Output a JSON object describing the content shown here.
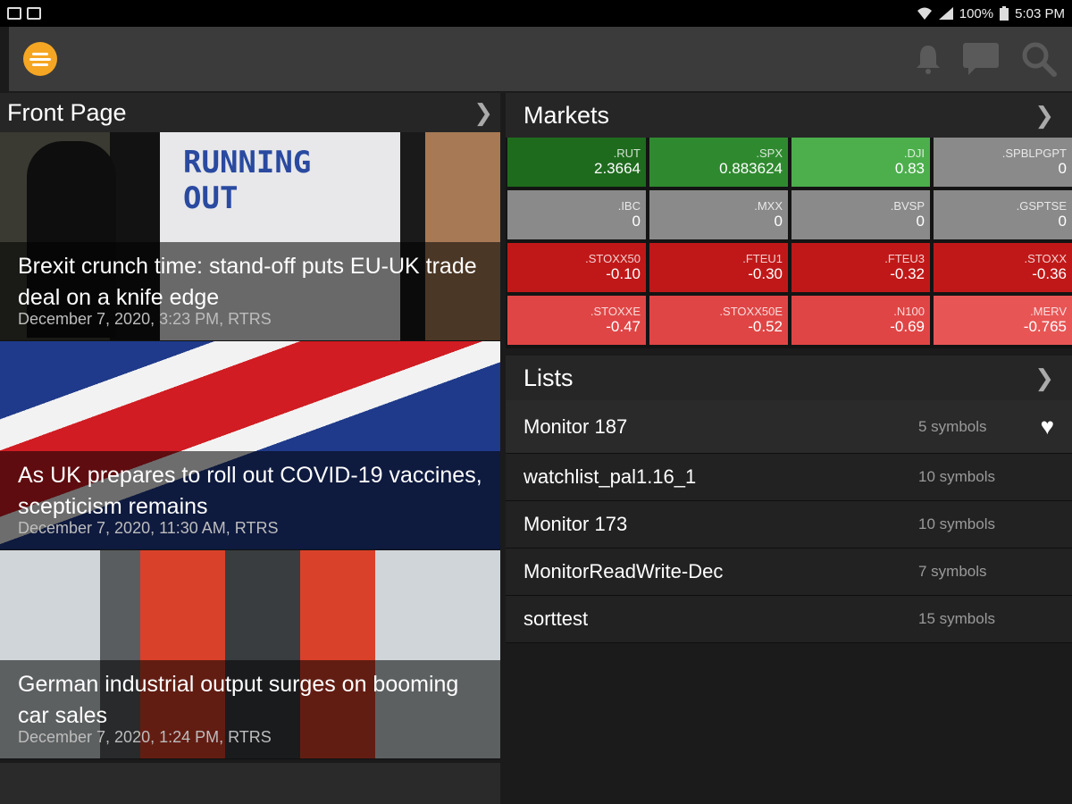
{
  "status_bar": {
    "battery": "100%",
    "time": "5:03 PM"
  },
  "app_bar": {
    "logo_icon": "eikon-logo",
    "actions": [
      "bell-icon",
      "chat-icon",
      "search-icon"
    ]
  },
  "front_page": {
    "title": "Front Page",
    "stories": [
      {
        "headline": "Brexit crunch time: stand-off puts EU-UK trade deal on a knife edge",
        "meta": "December 7, 2020, 3:23 PM, RTRS",
        "image_text": "RUNNING OUT"
      },
      {
        "headline": "As UK prepares to roll out COVID-19 vaccines, scepticism remains",
        "meta": "December 7, 2020, 11:30 AM, RTRS"
      },
      {
        "headline": "German industrial output surges on booming car sales",
        "meta": "December 7, 2020, 1:24 PM, RTRS"
      }
    ]
  },
  "markets": {
    "title": "Markets",
    "tiles": [
      {
        "symbol": ".RUT",
        "value": "2.3664",
        "color": "#1e6b1e"
      },
      {
        "symbol": ".SPX",
        "value": "0.883624",
        "color": "#2f8a2f"
      },
      {
        "symbol": ".DJI",
        "value": "0.83",
        "color": "#4caf4c"
      },
      {
        "symbol": ".SPBLPGPT",
        "value": "0",
        "color": "#8a8a8a"
      },
      {
        "symbol": ".IBC",
        "value": "0",
        "color": "#8a8a8a"
      },
      {
        "symbol": ".MXX",
        "value": "0",
        "color": "#8a8a8a"
      },
      {
        "symbol": ".BVSP",
        "value": "0",
        "color": "#8a8a8a"
      },
      {
        "symbol": ".GSPTSE",
        "value": "0",
        "color": "#8a8a8a"
      },
      {
        "symbol": ".STOXX50",
        "value": "-0.10",
        "color": "#c01818"
      },
      {
        "symbol": ".FTEU1",
        "value": "-0.30",
        "color": "#c01818"
      },
      {
        "symbol": ".FTEU3",
        "value": "-0.32",
        "color": "#c01818"
      },
      {
        "symbol": ".STOXX",
        "value": "-0.36",
        "color": "#c01818"
      },
      {
        "symbol": ".STOXXE",
        "value": "-0.47",
        "color": "#e04545"
      },
      {
        "symbol": ".STOXX50E",
        "value": "-0.52",
        "color": "#e04545"
      },
      {
        "symbol": ".N100",
        "value": "-0.69",
        "color": "#e04545"
      },
      {
        "symbol": ".MERV",
        "value": "-0.765",
        "color": "#e85555"
      }
    ]
  },
  "lists": {
    "title": "Lists",
    "items": [
      {
        "name": "Monitor 187",
        "count": "5 symbols",
        "favorite": true
      },
      {
        "name": "watchlist_pal1.16_1",
        "count": "10 symbols"
      },
      {
        "name": "Monitor 173",
        "count": "10 symbols"
      },
      {
        "name": "MonitorReadWrite-Dec",
        "count": "7 symbols"
      },
      {
        "name": "sorttest",
        "count": "15 symbols"
      }
    ]
  }
}
